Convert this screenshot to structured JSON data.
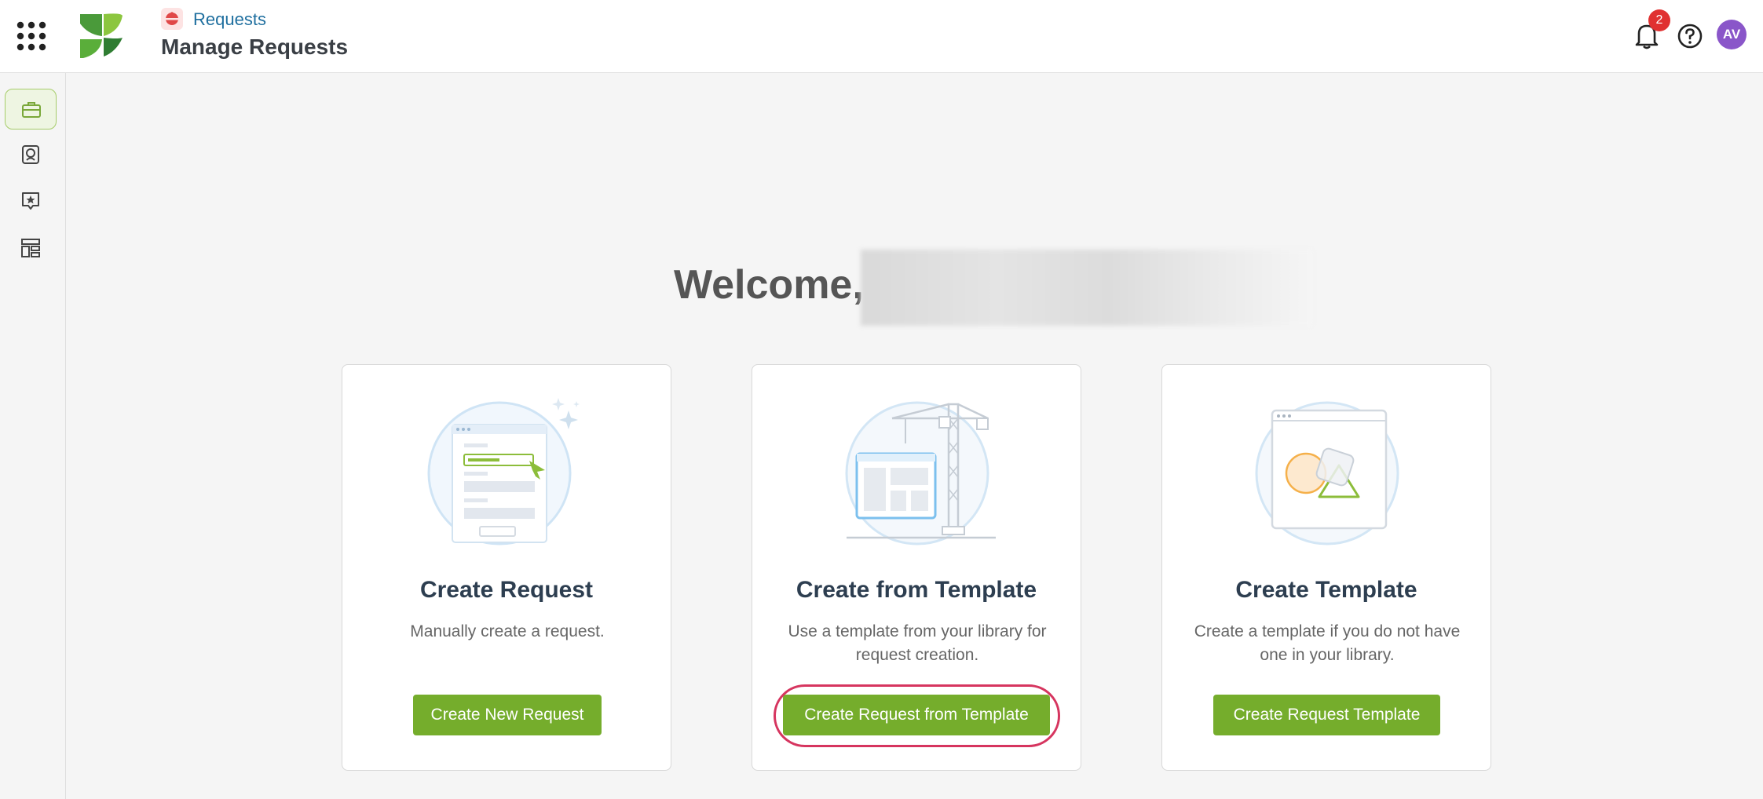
{
  "header": {
    "app_name": "Requests",
    "page_title": "Manage Requests",
    "notifications_count": "2",
    "avatar_initials": "AV"
  },
  "sidebar": {
    "items": [
      {
        "icon": "briefcase-icon",
        "active": true
      },
      {
        "icon": "contact-book-icon",
        "active": false
      },
      {
        "icon": "star-chat-icon",
        "active": false
      },
      {
        "icon": "layout-icon",
        "active": false
      }
    ]
  },
  "main": {
    "welcome_text": "Welcome,",
    "cards": [
      {
        "title": "Create Request",
        "description": "Manually create a request.",
        "button_label": "Create New Request"
      },
      {
        "title": "Create from Template",
        "description": "Use a template from your library for request creation.",
        "button_label": "Create Request from Template"
      },
      {
        "title": "Create Template",
        "description": "Create a template if you do not have one in your library.",
        "button_label": "Create Request Template"
      }
    ]
  },
  "colors": {
    "accent_green": "#75ad2c",
    "link_blue": "#1f6f9f",
    "highlight": "#d6355f",
    "badge_red": "#e03131",
    "avatar_purple": "#8a56c9"
  }
}
